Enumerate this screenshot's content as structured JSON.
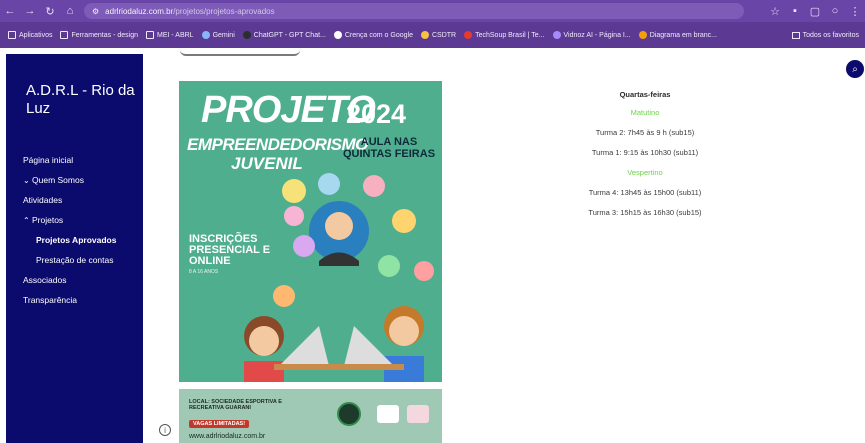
{
  "browser": {
    "url_host": "adrlriodaluz.com.br",
    "url_path": "/projetos/projetos-aprovados",
    "bookmarks": [
      {
        "label": "Aplicativos",
        "color": "#ffffff"
      },
      {
        "label": "Ferramentas - design",
        "color": "#ffffff"
      },
      {
        "label": "MEI - ABRL",
        "color": "#ffffff"
      },
      {
        "label": "Gemini",
        "color": "#8ab4f8"
      },
      {
        "label": "ChatGPT - GPT Chat...",
        "color": "#2d2d2d"
      },
      {
        "label": "Crença com o Google",
        "color": "#ffffff"
      },
      {
        "label": "CSDTR",
        "color": "#f6c343"
      },
      {
        "label": "TechSoup Brasil | Te...",
        "color": "#e33b2e"
      },
      {
        "label": "Vidnoz AI - Página I...",
        "color": "#a78bfa"
      },
      {
        "label": "Diagrama em branc...",
        "color": "#f59e0b"
      }
    ],
    "all_bookmarks_label": "Todos os favoritos"
  },
  "sidebar": {
    "title": "A.D.R.L - Rio da Luz",
    "items": [
      {
        "label": "Página inicial",
        "chevron": ""
      },
      {
        "label": "Quem Somos",
        "chevron": "⌄"
      },
      {
        "label": "Atividades",
        "chevron": ""
      },
      {
        "label": "Projetos",
        "chevron": "⌃"
      },
      {
        "label": "Projetos Aprovados",
        "chevron": ""
      },
      {
        "label": "Prestação de contas",
        "chevron": ""
      },
      {
        "label": "Associados",
        "chevron": ""
      },
      {
        "label": "Transparência",
        "chevron": ""
      }
    ]
  },
  "poster": {
    "title_line1": "PROJETO",
    "title_line2": "EMPREENDEDORISMO",
    "title_line3": "JUVENIL",
    "year": "2024",
    "aula": "AULA NAS QUINTAS FEIRAS",
    "inscricoes": "INSCRIÇÕES PRESENCIAL E ONLINE",
    "idade": "8 A 16 ANOS",
    "local": "LOCAL: SOCIEDADE ESPORTIVA E RECREATIVA GUARANI",
    "vagas": "VAGAS LIMITADAS!",
    "url": "www.adrlriodaluz.com.br",
    "colors": {
      "primary": "#4fae8d",
      "secondary": "#9fc9b4"
    }
  },
  "schedule": {
    "heading": "Quartas-feiras",
    "morning_label": "Matutino",
    "morning": [
      "Turma 2: 7h45 às 9 h (sub15)",
      "Turma 1: 9:15 às 10h30 (sub11)"
    ],
    "afternoon_label": "Vespertino",
    "afternoon": [
      "Turma 4: 13h45 às 15h00 (sub11)",
      "Turma 3: 15h15 às 16h30 (sub15)"
    ]
  },
  "colors": {
    "sidebar": "#0b0b6e",
    "accent_green": "#6dd24a",
    "browser": "#5c3a93"
  }
}
